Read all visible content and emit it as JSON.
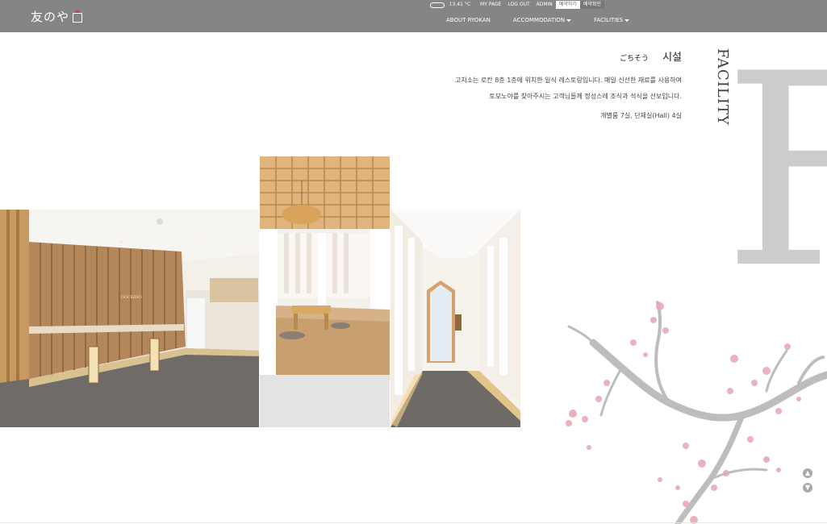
{
  "header": {
    "logo_text": "友のや",
    "utility": {
      "weather": "13.41 °C",
      "links": [
        "MY PAGE",
        "LOG OUT",
        "ADMIN"
      ],
      "reserve": "예약하기",
      "check": "예약확인"
    },
    "nav": [
      "ABOUT RYOKAN",
      "ACCOMMODATION",
      "FACILITIES"
    ]
  },
  "content": {
    "title_kana": "ごちそう",
    "title": "시설",
    "desc_line1": "고치소는 로칸 8층 1층에 위치한 일식 레스토랑입니다. 매일 신선한 재료를 사용하여",
    "desc_line2": "토모노야를 찾아주시는 고객님들께 정성스레 조식과 석식을 선보입니다.",
    "rooms": "개별룸 7실, 단체실(Hall) 4실",
    "vertical_word": "FACILITY",
    "big_letter": "F",
    "wall_sign": "GOCHISO"
  },
  "colors": {
    "header_bg": "#858585",
    "accent_gray": "#cfcfcf"
  },
  "icons": {
    "weather": "cloud-icon",
    "up": "arrow-up-icon",
    "down": "arrow-down-icon"
  }
}
